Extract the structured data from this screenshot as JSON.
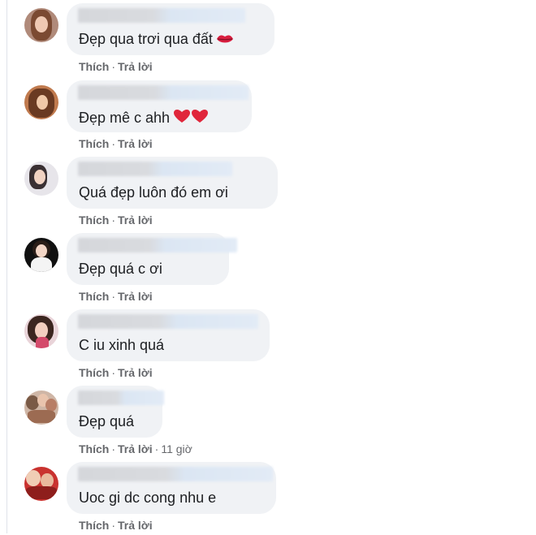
{
  "actions": {
    "like_label": "Thích",
    "separator": "·",
    "reply_label": "Trả lời"
  },
  "comments": [
    {
      "text": "Đẹp qua trơi qua đất",
      "emoji": "kiss-lips-icon",
      "timestamp": ""
    },
    {
      "text": "Đẹp mê c ahh",
      "emoji": "two-red-hearts-icon",
      "timestamp": ""
    },
    {
      "text": "Quá đẹp luôn đó em ơi",
      "emoji": "",
      "timestamp": ""
    },
    {
      "text": "Đẹp quá c ơi",
      "emoji": "",
      "timestamp": ""
    },
    {
      "text": "C iu xinh quá",
      "emoji": "",
      "timestamp": ""
    },
    {
      "text": "Đẹp quá",
      "emoji": "",
      "timestamp": "11 giờ"
    },
    {
      "text": "Uoc gi dc cong nhu e",
      "emoji": "",
      "timestamp": ""
    }
  ],
  "colors": {
    "bubble": "#f0f2f5",
    "text": "#1c1e21",
    "meta": "#65676b",
    "heart": "#e0263b"
  }
}
